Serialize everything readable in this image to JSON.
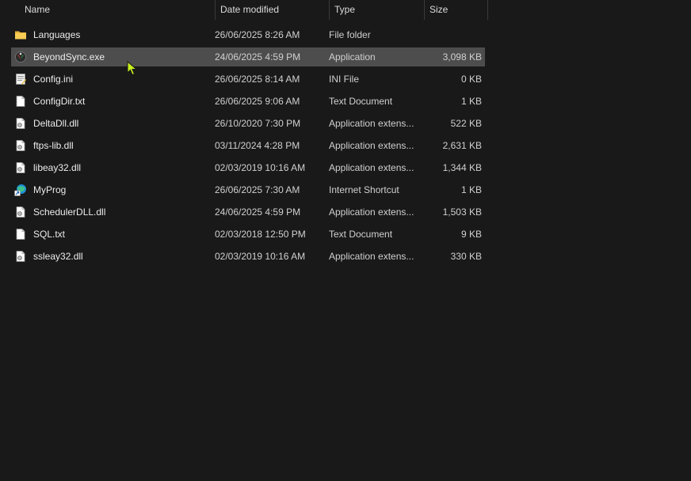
{
  "columns": {
    "name": "Name",
    "date_modified": "Date modified",
    "type": "Type",
    "size": "Size"
  },
  "files": [
    {
      "name": "Languages",
      "date": "26/06/2025 8:26 AM",
      "type": "File folder",
      "size": "",
      "icon": "folder-icon"
    },
    {
      "name": "BeyondSync.exe",
      "date": "24/06/2025 4:59 PM",
      "type": "Application",
      "size": "3,098 KB",
      "icon": "application-icon",
      "selected": true
    },
    {
      "name": "Config.ini",
      "date": "26/06/2025 8:14 AM",
      "type": "INI File",
      "size": "0 KB",
      "icon": "ini-file-icon"
    },
    {
      "name": "ConfigDir.txt",
      "date": "26/06/2025 9:06 AM",
      "type": "Text Document",
      "size": "1 KB",
      "icon": "text-file-icon"
    },
    {
      "name": "DeltaDll.dll",
      "date": "26/10/2020 7:30 PM",
      "type": "Application extens...",
      "size": "522 KB",
      "icon": "dll-file-icon"
    },
    {
      "name": "ftps-lib.dll",
      "date": "03/11/2024 4:28 PM",
      "type": "Application extens...",
      "size": "2,631 KB",
      "icon": "dll-file-icon"
    },
    {
      "name": "libeay32.dll",
      "date": "02/03/2019 10:16 AM",
      "type": "Application extens...",
      "size": "1,344 KB",
      "icon": "dll-file-icon"
    },
    {
      "name": "MyProg",
      "date": "26/06/2025 7:30 AM",
      "type": "Internet Shortcut",
      "size": "1 KB",
      "icon": "internet-shortcut-icon"
    },
    {
      "name": "SchedulerDLL.dll",
      "date": "24/06/2025 4:59 PM",
      "type": "Application extens...",
      "size": "1,503 KB",
      "icon": "dll-file-icon"
    },
    {
      "name": "SQL.txt",
      "date": "02/03/2018 12:50 PM",
      "type": "Text Document",
      "size": "9 KB",
      "icon": "text-file-icon"
    },
    {
      "name": "ssleay32.dll",
      "date": "02/03/2019 10:16 AM",
      "type": "Application extens...",
      "size": "330 KB",
      "icon": "dll-file-icon"
    }
  ],
  "colors": {
    "background": "#191919",
    "selected_row": "#4d4d4d",
    "folder": "#f0c24b",
    "cursor": "#c6f01e"
  }
}
